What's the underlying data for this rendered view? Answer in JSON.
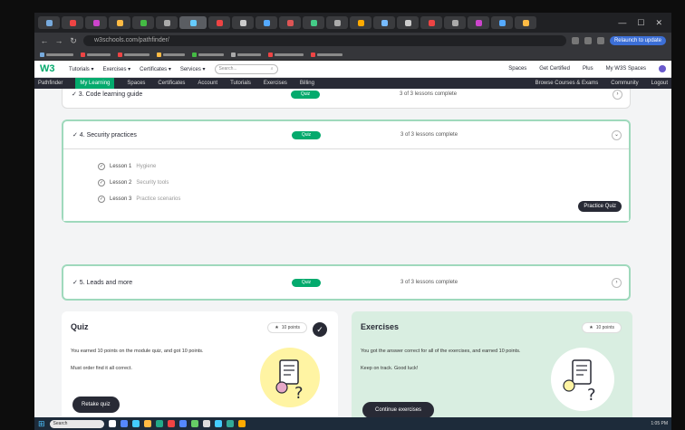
{
  "browser": {
    "url": "w3schools.com/pathfinder/",
    "relaunch_label": "Relaunch to update",
    "tabs": [
      {
        "color": "#7ad"
      },
      {
        "color": "#e44"
      },
      {
        "color": "#c4c"
      },
      {
        "color": "#fb4"
      },
      {
        "color": "#4b4"
      },
      {
        "color": "#aaa"
      },
      {
        "color": "#6cf",
        "active": true
      },
      {
        "color": "#e44"
      },
      {
        "color": "#ccc"
      },
      {
        "color": "#5af"
      },
      {
        "color": "#d55"
      },
      {
        "color": "#4c8"
      },
      {
        "color": "#aaa"
      },
      {
        "color": "#fa0"
      },
      {
        "color": "#7bf"
      },
      {
        "color": "#ccc"
      },
      {
        "color": "#e44"
      },
      {
        "color": "#aaa"
      },
      {
        "color": "#c4c"
      },
      {
        "color": "#5af"
      },
      {
        "color": "#fb4"
      }
    ]
  },
  "site": {
    "logo": "W3",
    "menu": [
      "Tutorials ▾",
      "Exercises ▾",
      "Certificates ▾",
      "Services ▾"
    ],
    "search_placeholder": "Search...",
    "right": [
      "Spaces",
      "Get Certified",
      "Plus",
      "My W3S Spaces"
    ],
    "subnav": [
      "Pathfinder",
      "My Learning",
      "Spaces",
      "Certificates",
      "Account",
      "Tutorials",
      "Exercises",
      "Billing"
    ],
    "subnav_active": 1,
    "subnav_right": [
      "Browse Courses & Exams",
      "Community",
      "Logout"
    ]
  },
  "modules": [
    {
      "title": "✓  3. Code learning guide",
      "pill": "Quiz",
      "progress": "3 of 3 lessons complete",
      "chev": "›"
    },
    {
      "title": "✓  4. Security practices",
      "pill": "Quiz",
      "progress": "3 of 3 lessons complete",
      "chev": "⌄",
      "lessons": [
        {
          "name": "Lesson 1",
          "sub": "Hygiene"
        },
        {
          "name": "Lesson 2",
          "sub": "Security tools"
        },
        {
          "name": "Lesson 3",
          "sub": "Practice scenarios"
        }
      ],
      "practice_label": "Practice Quiz"
    },
    {
      "title": "✓  5. Leads and more",
      "pill": "Quiz",
      "progress": "3 of 3 lessons complete",
      "chev": "›"
    }
  ],
  "quiz": {
    "title": "Quiz",
    "points": "10 points",
    "desc": "You earned 10 points on the module quiz, and got 10 points.",
    "desc2": "Must order find it all correct.",
    "cta": "Retake quiz"
  },
  "exercises": {
    "title": "Exercises",
    "points": "10 points",
    "desc": "You got the answer correct for all of the exercises, and earned 10 points.",
    "desc2": "Keep on track. Good luck!",
    "cta": "Continue exercises"
  },
  "taskbar": {
    "search": "Search",
    "clock": "1:05 PM",
    "apps": [
      "#fff",
      "#58f",
      "#4cf",
      "#fb4",
      "#2a8",
      "#e44",
      "#58f",
      "#6c6",
      "#ddd",
      "#4cf",
      "#3a9",
      "#fa0"
    ]
  }
}
